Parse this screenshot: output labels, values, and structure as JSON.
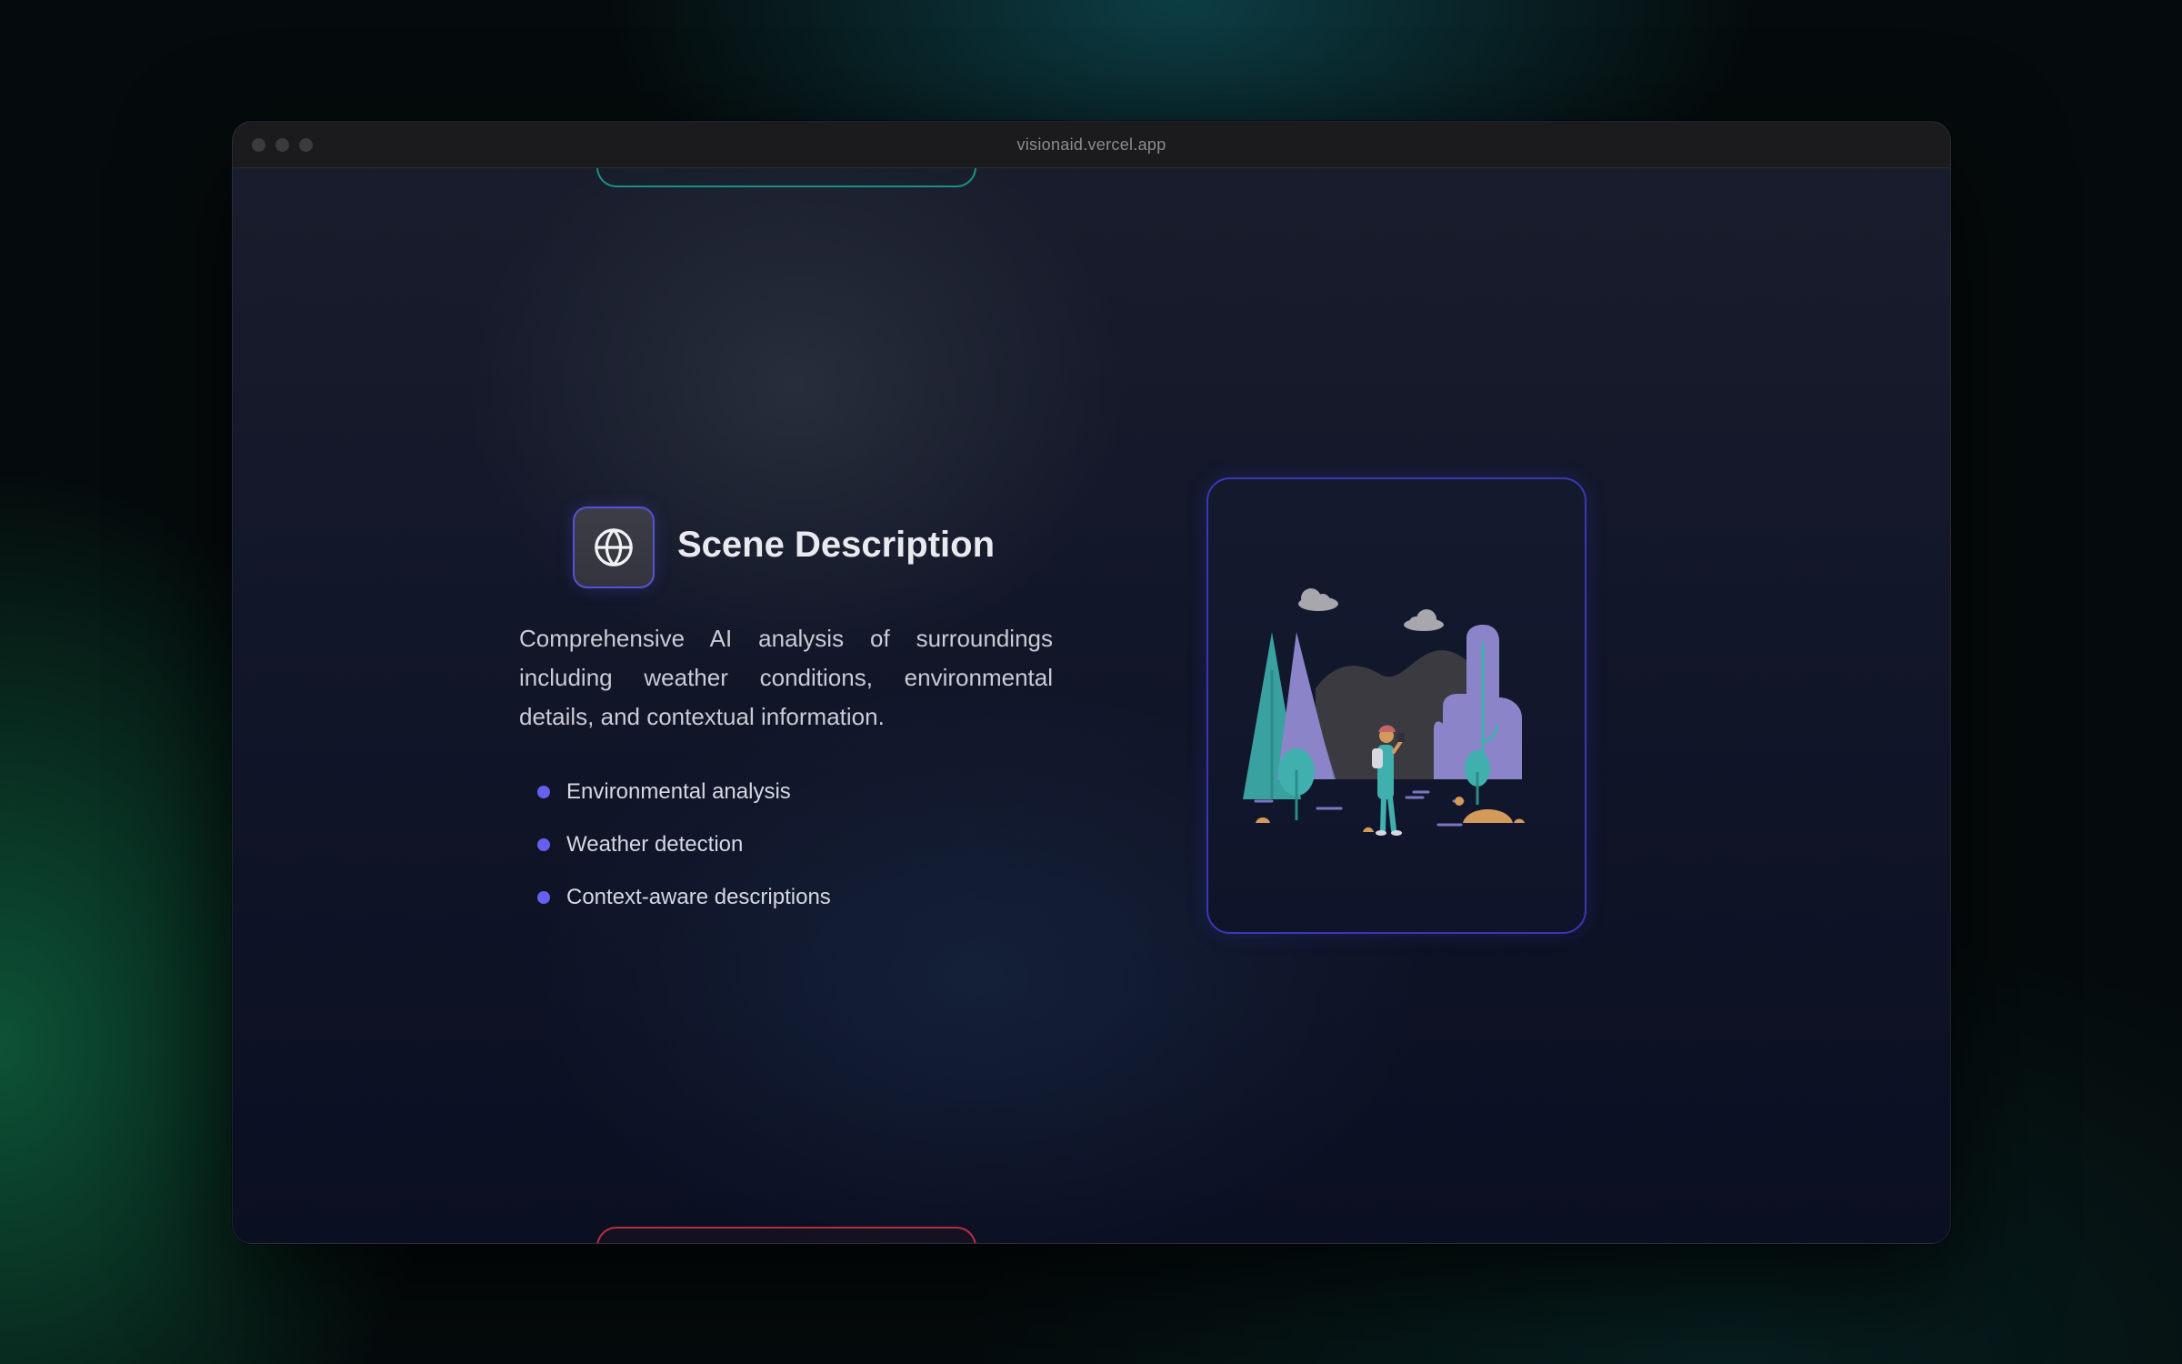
{
  "window": {
    "url": "visionaid.vercel.app"
  },
  "feature": {
    "icon": "globe-icon",
    "title": "Scene Description",
    "description": "Comprehensive AI analysis of surroundings including weather conditions, environmental details, and contextual information.",
    "bullets": [
      "Environmental analysis",
      "Weather detection",
      "Context-aware descriptions"
    ]
  },
  "illustration": {
    "icon": "outdoor-scene-illustration"
  },
  "colors": {
    "accent": "#6660f0",
    "icon_border": "#5652d6",
    "card_border": "#3a37b4",
    "teal_pill": "#1a8f86",
    "red_pill": "#b5303f"
  }
}
